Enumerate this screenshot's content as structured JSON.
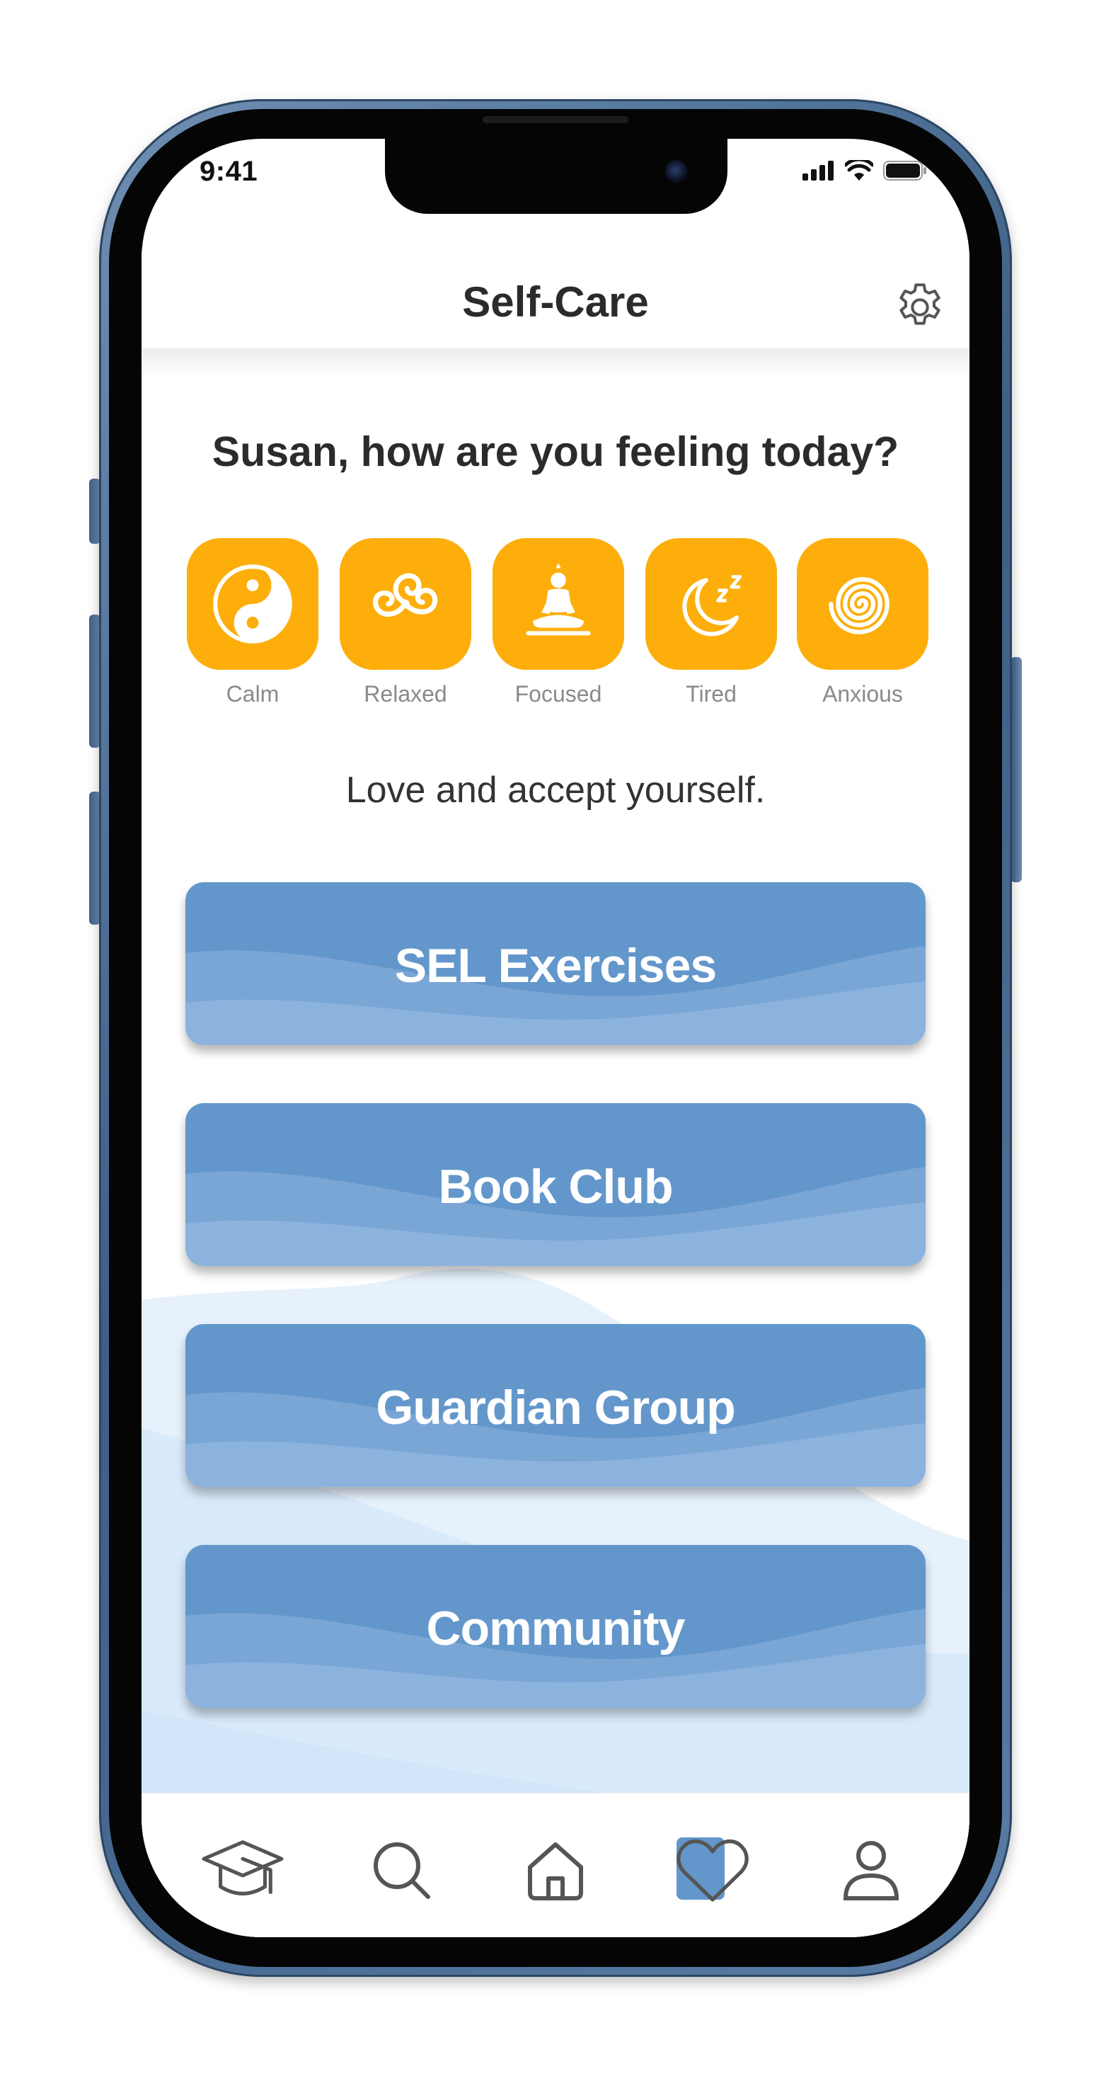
{
  "status_bar": {
    "time": "9:41"
  },
  "header": {
    "title": "Self-Care",
    "settings_icon": "gear-icon"
  },
  "greeting": "Susan, how are you feeling today?",
  "moods": [
    {
      "label": "Calm",
      "icon": "yin-yang-icon"
    },
    {
      "label": "Relaxed",
      "icon": "triskelion-icon"
    },
    {
      "label": "Focused",
      "icon": "meditating-person-icon"
    },
    {
      "label": "Tired",
      "icon": "moon-zzz-icon"
    },
    {
      "label": "Anxious",
      "icon": "spiral-icon"
    }
  ],
  "affirmation": "Love and accept yourself.",
  "cards": [
    {
      "label": "SEL Exercises"
    },
    {
      "label": "Book Club"
    },
    {
      "label": "Guardian Group"
    },
    {
      "label": "Community"
    }
  ],
  "tabbar": {
    "items": [
      {
        "icon": "graduation-cap-icon",
        "active": false
      },
      {
        "icon": "search-icon",
        "active": false
      },
      {
        "icon": "home-icon",
        "active": false
      },
      {
        "icon": "heart-icon",
        "active": true
      },
      {
        "icon": "profile-icon",
        "active": false
      }
    ]
  },
  "colors": {
    "mood_tile": "#FDAE0A",
    "card": "#6397cb",
    "active_tab": "#6397cb",
    "phone_frame": "#3c5f86"
  }
}
